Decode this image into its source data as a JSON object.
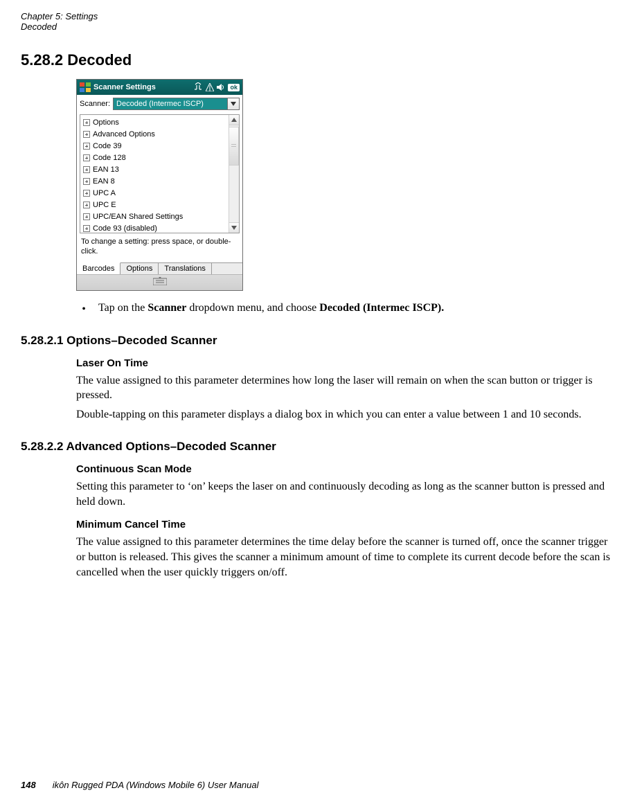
{
  "header": {
    "line1": "Chapter 5: Settings",
    "line2": "Decoded"
  },
  "section_title": "5.28.2   Decoded",
  "screenshot": {
    "title": "Scanner Settings",
    "ok_label": "ok",
    "scanner_label": "Scanner:",
    "scanner_selected": "Decoded (Intermec ISCP)",
    "tree_items": [
      "Options",
      "Advanced Options",
      "Code 39",
      "Code 128",
      "EAN 13",
      "EAN 8",
      "UPC A",
      "UPC E",
      "UPC/EAN Shared Settings",
      "Code 93 (disabled)"
    ],
    "hint": "To change a setting: press space, or double-click.",
    "tabs": [
      "Barcodes",
      "Options",
      "Translations"
    ]
  },
  "bullet": {
    "pre": "Tap on the ",
    "bold1": "Scanner",
    "mid": " dropdown menu, and choose ",
    "bold2": "Decoded (Intermec ISCP)."
  },
  "sec1_title": "5.28.2.1 Options–Decoded Scanner",
  "sec1_h4": "Laser On Time",
  "sec1_p1": "The value assigned to this parameter determines how long the laser will remain on when the scan button or trigger is pressed.",
  "sec1_p2": "Double-tapping on this parameter displays a dialog box in which you can enter a value between 1 and 10 seconds.",
  "sec2_title": "5.28.2.2 Advanced Options–Decoded Scanner",
  "sec2_h4a": "Continuous Scan Mode",
  "sec2_p1": "Setting this parameter to ‘on’ keeps the laser on and continuously decoding as long as the scanner button is pressed and held down.",
  "sec2_h4b": "Minimum Cancel Time",
  "sec2_p2": "The value assigned to this parameter determines the time delay before the scanner is turned off, once the scanner trigger or button is released. This gives the scanner a minimum amount of time to complete its current decode before the scan is cancelled when the user quickly triggers on/off.",
  "footer": {
    "page": "148",
    "manual": "ikôn Rugged PDA (Windows Mobile 6) User Manual"
  }
}
